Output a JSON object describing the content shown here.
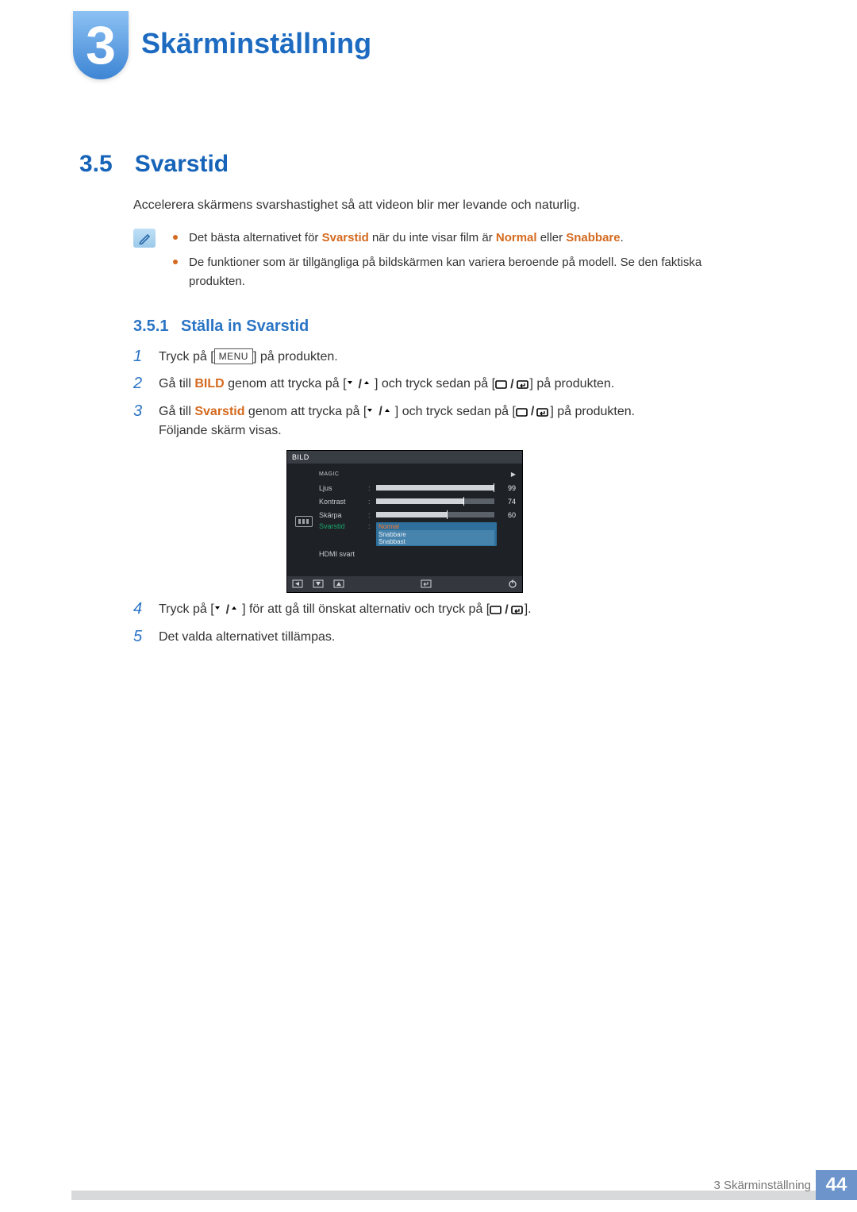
{
  "chapter": {
    "number": "3",
    "title": "Skärminställning"
  },
  "section": {
    "number": "3.5",
    "title": "Svarstid"
  },
  "intro": "Accelerera skärmens svarshastighet så att videon blir mer levande och naturlig.",
  "notes": {
    "items": [
      {
        "pre": "Det bästa alternativet för ",
        "hl1": "Svarstid",
        "mid": " när du inte visar film är ",
        "hl2": "Normal",
        "mid2": " eller ",
        "hl3": "Snabbare",
        "post": "."
      },
      {
        "text": "De funktioner som är tillgängliga på bildskärmen kan variera beroende på modell. Se den faktiska produkten."
      }
    ]
  },
  "subsection": {
    "number": "3.5.1",
    "title": "Ställa in Svarstid"
  },
  "steps": [
    {
      "n": "1",
      "pre": "Tryck på [",
      "menu": "MENU",
      "post": "] på produkten."
    },
    {
      "n": "2",
      "pre": "Gå till ",
      "hl": "BILD",
      "mid": " genom att trycka på [",
      "mid2": "] och tryck sedan på [",
      "post": "] på produkten."
    },
    {
      "n": "3",
      "pre": "Gå till ",
      "hl": "Svarstid",
      "mid": " genom att trycka på [",
      "mid2": "] och tryck sedan på [",
      "post": "] på produkten.",
      "tail": "Följande skärm visas."
    },
    {
      "n": "4",
      "pre": "Tryck på [",
      "mid": "] för att gå till önskat alternativ och tryck på [",
      "post": "]."
    },
    {
      "n": "5",
      "text": "Det valda alternativet tillämpas."
    }
  ],
  "osd": {
    "title": "BILD",
    "rows": {
      "magic": "MAGIC",
      "ljus": {
        "label": "Ljus",
        "value": "99",
        "pct": 99
      },
      "kontrast": {
        "label": "Kontrast",
        "value": "74",
        "pct": 74
      },
      "skarpa": {
        "label": "Skärpa",
        "value": "60",
        "pct": 60
      },
      "svarstid": {
        "label": "Svarstid",
        "selected": "Normal",
        "opts": [
          "Snabbare",
          "Snabbast"
        ]
      },
      "hdmi": {
        "label": "HDMI svart"
      }
    }
  },
  "footer": {
    "text": "3 Skärminställning",
    "page": "44"
  }
}
